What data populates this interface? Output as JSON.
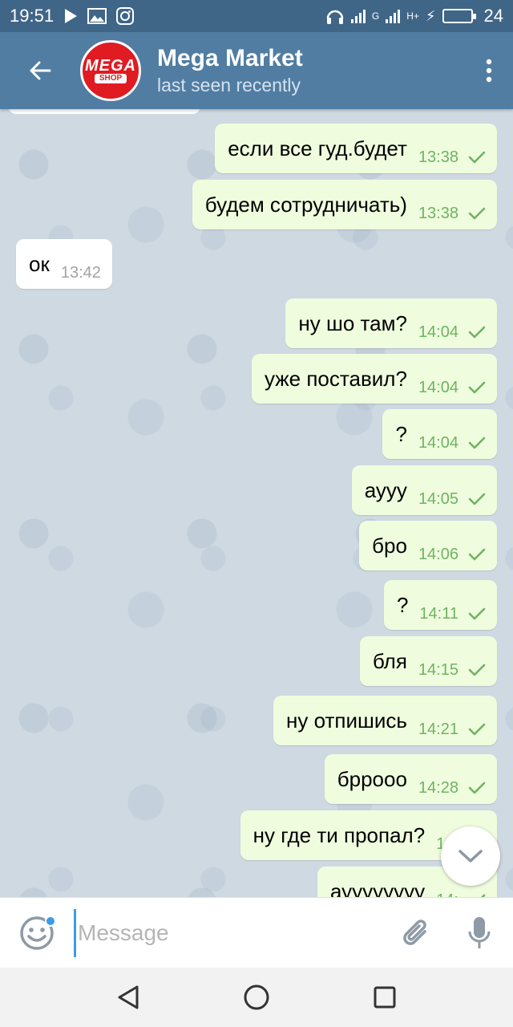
{
  "status_bar": {
    "time": "19:51",
    "battery_level": "24",
    "net1": "G",
    "net2": "H+"
  },
  "header": {
    "title": "Mega Market",
    "subtitle": "last seen recently",
    "avatar_line1": "MEGA",
    "avatar_line2": "SHOP"
  },
  "messages": [
    {
      "dir": "out",
      "text": "если все гуд.будет",
      "time": "13:38",
      "read": true
    },
    {
      "dir": "out",
      "text": "будем сотрудничать)",
      "time": "13:38",
      "read": true
    },
    {
      "dir": "in",
      "text": "ок",
      "time": "13:42"
    },
    {
      "dir": "out",
      "text": "ну шо там?",
      "time": "14:04",
      "read": true
    },
    {
      "dir": "out",
      "text": "уже поставил?",
      "time": "14:04",
      "read": true
    },
    {
      "dir": "out",
      "text": "?",
      "time": "14:04",
      "read": true
    },
    {
      "dir": "out",
      "text": "аууу",
      "time": "14:05",
      "read": true
    },
    {
      "dir": "out",
      "text": "бро",
      "time": "14:06",
      "read": true
    },
    {
      "dir": "out",
      "text": "?",
      "time": "14:11",
      "read": true
    },
    {
      "dir": "out",
      "text": "бля",
      "time": "14:15",
      "read": true
    },
    {
      "dir": "out",
      "text": "ну отпишись",
      "time": "14:21",
      "read": true
    },
    {
      "dir": "out",
      "text": "бррооо",
      "time": "14:28",
      "read": true
    },
    {
      "dir": "out",
      "text": "ну где ти пропал?",
      "time": "14:",
      "read": true
    },
    {
      "dir": "out",
      "text": "ауууууууу",
      "time": "14:",
      "read": true
    }
  ],
  "input": {
    "placeholder": "Message",
    "value": ""
  },
  "colors": {
    "header": "#517da2",
    "status_bar": "#3f6587",
    "outgoing_bubble": "#effdde",
    "time_outgoing": "#6fb363",
    "accent": "#3a9ce4"
  },
  "icons": [
    "back-arrow-icon",
    "more-vert-icon",
    "emoji-icon",
    "attach-icon",
    "mic-icon",
    "chevron-down-icon",
    "nav-back-icon",
    "nav-home-icon",
    "nav-recents-icon"
  ]
}
